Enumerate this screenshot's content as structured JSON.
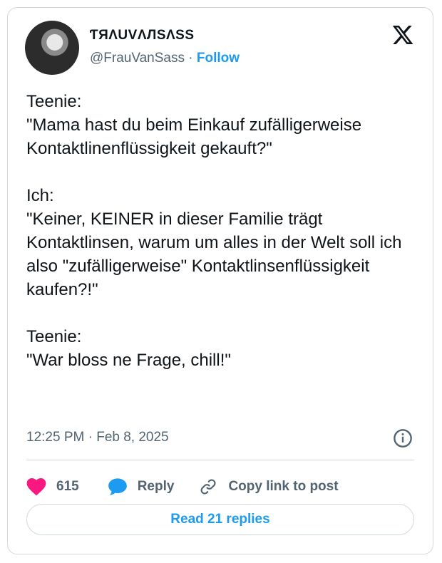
{
  "user": {
    "display_name": "ƬЯΛUVΛЛSΛSS",
    "handle": "@FrauVanSass",
    "separator": " · ",
    "follow_label": "Follow"
  },
  "tweet": {
    "text": "Teenie:\n\"Mama hast du beim Einkauf zufälligerweise Kontaktlinenflüssigkeit gekauft?\"\n\nIch:\n\"Keiner, KEINER in dieser Familie trägt Kontaktlinsen, warum um alles in der Welt soll ich also \"zufälligerweise\" Kontaktlinsenflüssigkeit kaufen?!\"\n\nTeenie:\n\"War bloss ne Frage, chill!\"",
    "timestamp": "12:25 PM · Feb 8, 2025"
  },
  "actions": {
    "like_count": "615",
    "reply_label": "Reply",
    "copy_link_label": "Copy link to post"
  },
  "read_replies_label": "Read 21 replies",
  "colors": {
    "accent": "#1d9bf0",
    "like": "#f91880",
    "muted": "#536471",
    "text": "#0f1419",
    "border": "#cfd9de"
  },
  "icons": [
    "x-logo-icon",
    "info-icon",
    "heart-icon",
    "reply-bubble-icon",
    "link-icon"
  ]
}
